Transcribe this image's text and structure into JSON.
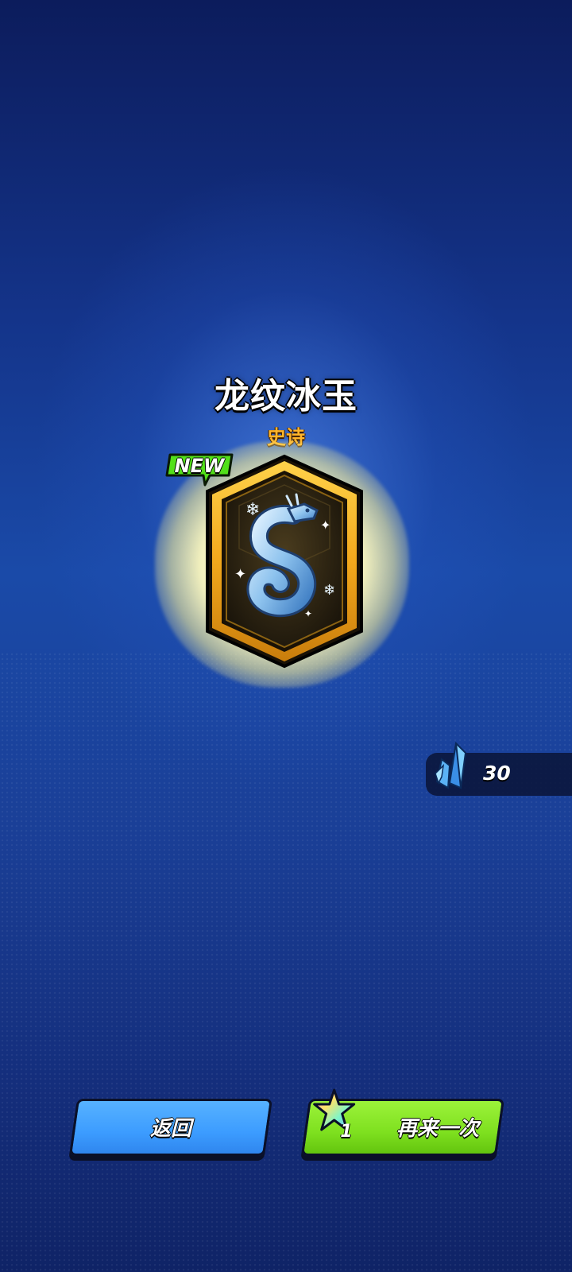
{
  "reward": {
    "name": "龙纹冰玉",
    "rarity": "史诗",
    "new_badge": "NEW",
    "icon": "ice-jade-dragon-icon",
    "frame_color": "#f2a81c"
  },
  "currency": {
    "icon": "blue-crystal-icon",
    "amount": "30"
  },
  "buttons": {
    "back_label": "返回",
    "again_label": "再来一次",
    "again_cost": "1",
    "again_cost_icon": "rainbow-star-icon"
  },
  "colors": {
    "back_button": "#3c9cff",
    "again_button": "#7ee01f",
    "rarity_text": "#ffb52a"
  }
}
